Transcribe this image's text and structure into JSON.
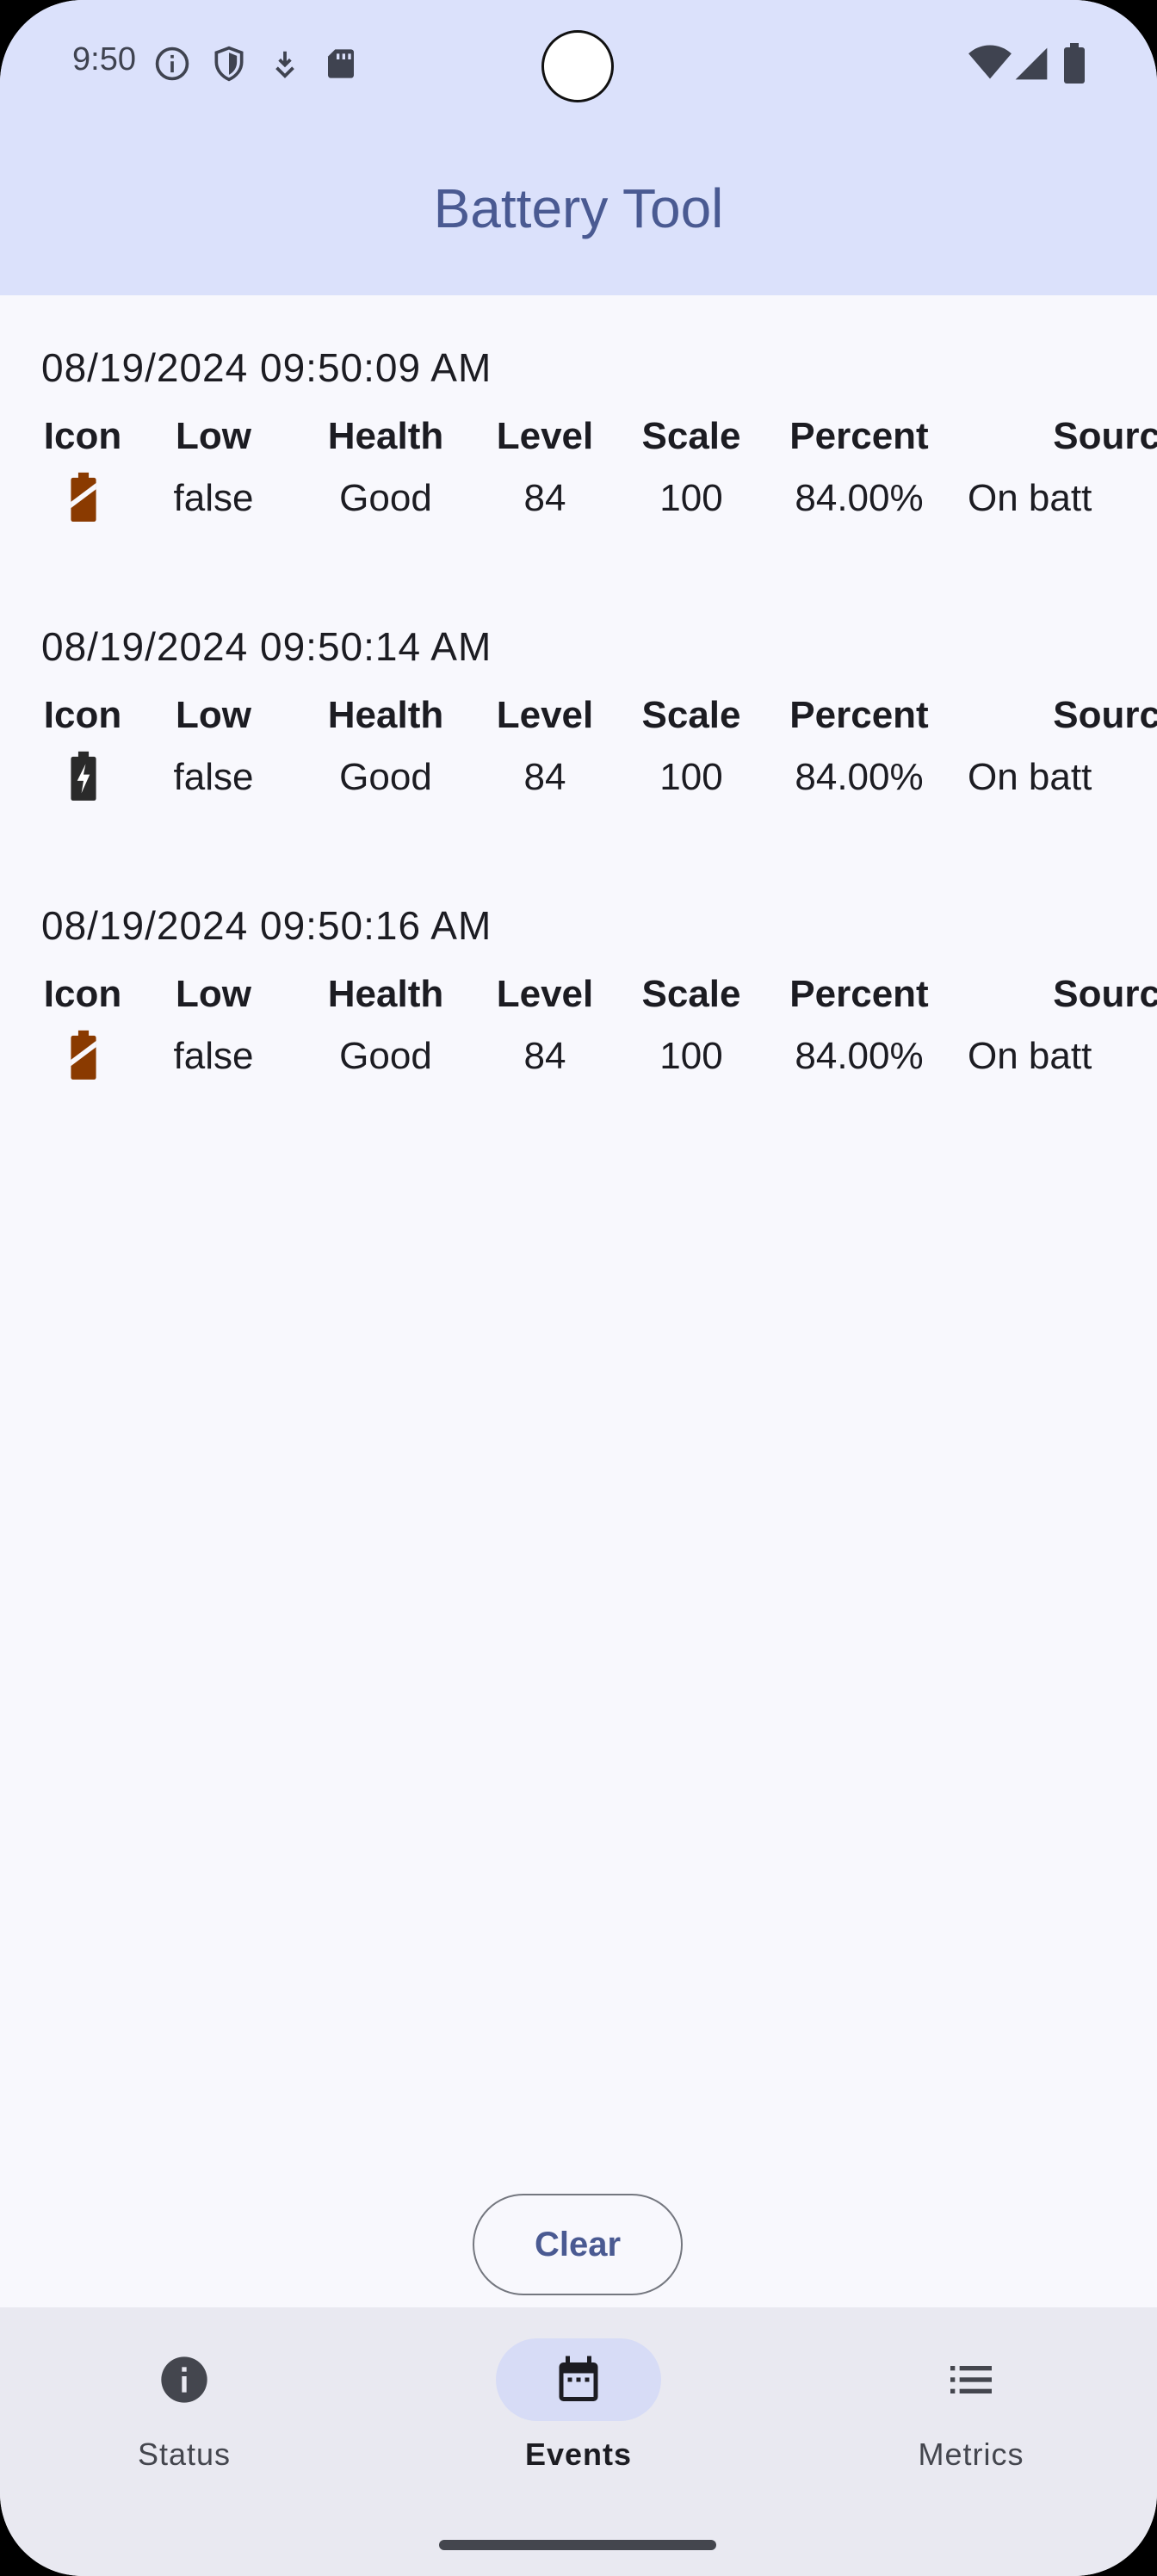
{
  "status_bar": {
    "time": "9:50",
    "icons_left": [
      "info-icon",
      "shield-icon",
      "download-icon",
      "sdcard-icon"
    ],
    "icons_right": [
      "wifi-icon",
      "signal-icon",
      "battery-icon"
    ]
  },
  "app_bar": {
    "title": "Battery Tool"
  },
  "columns": {
    "icon": "Icon",
    "low": "Low",
    "health": "Health",
    "level": "Level",
    "scale": "Scale",
    "percent": "Percent",
    "source": "Sourc"
  },
  "events": [
    {
      "timestamp": "08/19/2024 09:50:09 AM",
      "icon": "battery-discharging-icon",
      "icon_color": "#8a3a00",
      "low": "false",
      "health": "Good",
      "level": "84",
      "scale": "100",
      "percent": "84.00%",
      "source": "On batt"
    },
    {
      "timestamp": "08/19/2024 09:50:14 AM",
      "icon": "battery-charging-icon",
      "icon_color": "#2a2a2a",
      "low": "false",
      "health": "Good",
      "level": "84",
      "scale": "100",
      "percent": "84.00%",
      "source": "On batt"
    },
    {
      "timestamp": "08/19/2024 09:50:16 AM",
      "icon": "battery-discharging-icon",
      "icon_color": "#8a3a00",
      "low": "false",
      "health": "Good",
      "level": "84",
      "scale": "100",
      "percent": "84.00%",
      "source": "On batt"
    }
  ],
  "clear_button": {
    "label": "Clear"
  },
  "bottom_nav": {
    "items": [
      {
        "label": "Status",
        "icon": "info-icon",
        "active": false
      },
      {
        "label": "Events",
        "icon": "calendar-icon",
        "active": true
      },
      {
        "label": "Metrics",
        "icon": "list-icon",
        "active": false
      }
    ]
  },
  "colors": {
    "app_bar_bg": "#dbe1fb",
    "title": "#4a5a92",
    "background": "#f8f8fd",
    "nav_bg": "#e9e9f1",
    "active_pill": "#d7dcf6"
  }
}
